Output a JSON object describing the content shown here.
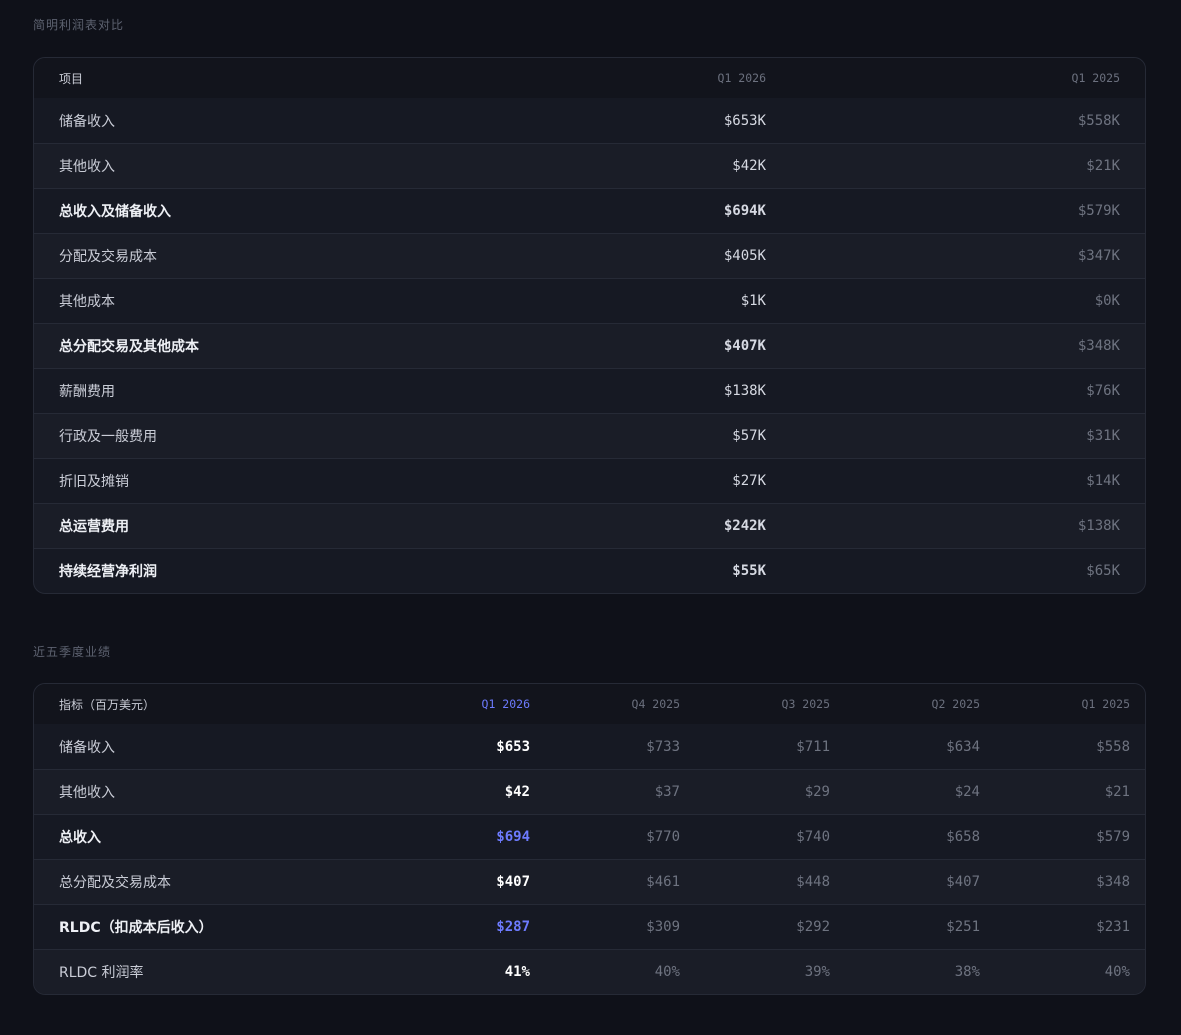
{
  "income_section": {
    "title": "简明利润表对比",
    "headers": {
      "item": "项目",
      "current": "Q1 2026",
      "prior": "Q1 2025"
    },
    "rows": [
      {
        "label": "储备收入",
        "current": "$653K",
        "prior": "$558K",
        "bold": false
      },
      {
        "label": "其他收入",
        "current": "$42K",
        "prior": "$21K",
        "bold": false
      },
      {
        "label": "总收入及储备收入",
        "current": "$694K",
        "prior": "$579K",
        "bold": true
      },
      {
        "label": "分配及交易成本",
        "current": "$405K",
        "prior": "$347K",
        "bold": false
      },
      {
        "label": "其他成本",
        "current": "$1K",
        "prior": "$0K",
        "bold": false
      },
      {
        "label": "总分配交易及其他成本",
        "current": "$407K",
        "prior": "$348K",
        "bold": true
      },
      {
        "label": "薪酬费用",
        "current": "$138K",
        "prior": "$76K",
        "bold": false
      },
      {
        "label": "行政及一般费用",
        "current": "$57K",
        "prior": "$31K",
        "bold": false
      },
      {
        "label": "折旧及摊销",
        "current": "$27K",
        "prior": "$14K",
        "bold": false
      },
      {
        "label": "总运营费用",
        "current": "$242K",
        "prior": "$138K",
        "bold": true
      },
      {
        "label": "持续经营净利润",
        "current": "$55K",
        "prior": "$65K",
        "bold": true
      }
    ]
  },
  "quarterly_section": {
    "title": "近五季度业绩",
    "headers": [
      "指标（百万美元）",
      "Q1 2026",
      "Q4 2025",
      "Q3 2025",
      "Q2 2025",
      "Q1 2025"
    ],
    "rows": [
      {
        "label": "储备收入",
        "values": [
          "$653",
          "$733",
          "$711",
          "$634",
          "$558"
        ],
        "bold": false,
        "accent": false
      },
      {
        "label": "其他收入",
        "values": [
          "$42",
          "$37",
          "$29",
          "$24",
          "$21"
        ],
        "bold": false,
        "accent": false
      },
      {
        "label": "总收入",
        "values": [
          "$694",
          "$770",
          "$740",
          "$658",
          "$579"
        ],
        "bold": true,
        "accent": true
      },
      {
        "label": "总分配及交易成本",
        "values": [
          "$407",
          "$461",
          "$448",
          "$407",
          "$348"
        ],
        "bold": false,
        "accent": false
      },
      {
        "label": "RLDC（扣成本后收入）",
        "values": [
          "$287",
          "$309",
          "$292",
          "$251",
          "$231"
        ],
        "bold": true,
        "accent": true
      },
      {
        "label": "RLDC 利润率",
        "values": [
          "41%",
          "40%",
          "39%",
          "38%",
          "40%"
        ],
        "bold": false,
        "accent": false
      }
    ]
  },
  "colors": {
    "background": "#0f1119",
    "panel": "#161923",
    "accent": "#6d7bff",
    "muted": "#6e7380"
  }
}
